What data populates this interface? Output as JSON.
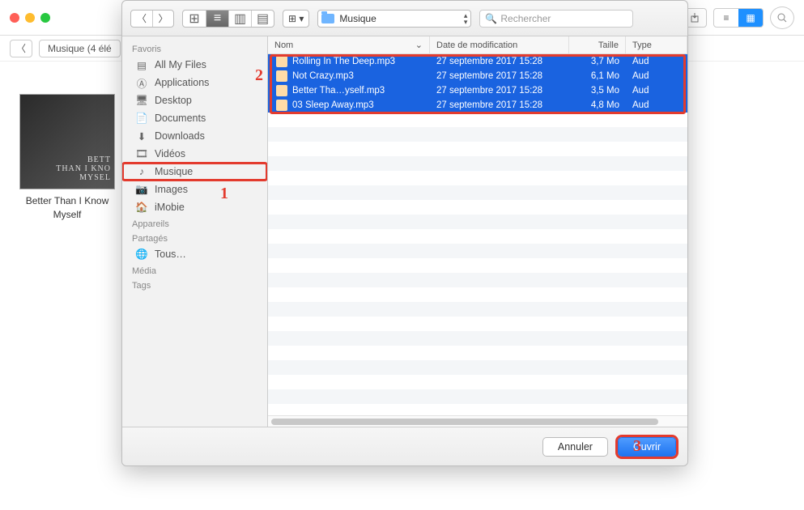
{
  "bg": {
    "breadcrumb": "Musique (4 élé",
    "album_caption": "Better Than I Know Myself"
  },
  "dialog": {
    "folder_label": "Musique",
    "search_placeholder": "Rechercher",
    "sidebar": {
      "favorites_label": "Favoris",
      "devices_label": "Appareils",
      "shared_label": "Partagés",
      "media_label": "Média",
      "tags_label": "Tags",
      "all_my_files": "All My Files",
      "applications": "Applications",
      "desktop": "Desktop",
      "documents": "Documents",
      "downloads": "Downloads",
      "videos": "Vidéos",
      "music": "Musique",
      "images": "Images",
      "imobie": "iMobie",
      "shared_all": "Tous…"
    },
    "columns": {
      "name": "Nom",
      "date": "Date de modification",
      "size": "Taille",
      "kind": "Type"
    },
    "files": [
      {
        "name": "Rolling In The Deep.mp3",
        "date": "27 septembre 2017 15:28",
        "size": "3,7 Mo",
        "kind": "Aud"
      },
      {
        "name": "Not Crazy.mp3",
        "date": "27 septembre 2017 15:28",
        "size": "6,1 Mo",
        "kind": "Aud"
      },
      {
        "name": "Better Tha…yself.mp3",
        "date": "27 septembre 2017 15:28",
        "size": "3,5 Mo",
        "kind": "Aud"
      },
      {
        "name": "03 Sleep Away.mp3",
        "date": "27 septembre 2017 15:28",
        "size": "4,8 Mo",
        "kind": "Aud"
      }
    ],
    "buttons": {
      "cancel": "Annuler",
      "open": "Ouvrir"
    }
  },
  "callouts": {
    "one": "1",
    "two": "2",
    "three": "3"
  }
}
